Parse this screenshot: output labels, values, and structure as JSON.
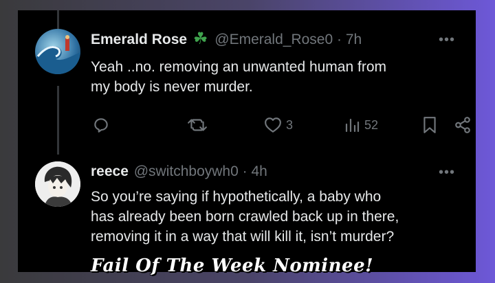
{
  "tweets": [
    {
      "name": "Emerald Rose",
      "badge": "☘",
      "handle": "@Emerald_Rose0",
      "separator": "·",
      "time": "7h",
      "text_line1": "Yeah ..no. removing an unwanted human from",
      "text_line2": "my body is never murder.",
      "likes": "3",
      "views": "52"
    },
    {
      "name": "reece",
      "handle": "@switchboywh0",
      "separator": "·",
      "time": "4h",
      "text_line1": "So you’re saying if hypothetically, a baby who",
      "text_line2": "has already been born crawled back up in there,",
      "text_line3": "removing it in a way that will kill it, isn’t murder?"
    }
  ],
  "more_glyph": "•••",
  "banner_text": "Fail Of The Week Nominee!",
  "colors": {
    "background": "#000000",
    "primary_text": "#e7e9ea",
    "secondary_text": "#71767b",
    "badge_green": "#3fa34d"
  },
  "icons": [
    "reply-icon",
    "retweet-icon",
    "like-icon",
    "views-icon",
    "bookmark-icon",
    "share-icon",
    "more-icon"
  ]
}
